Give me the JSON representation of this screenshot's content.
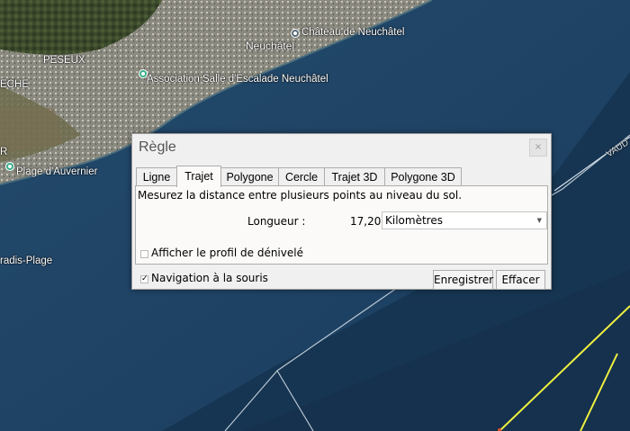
{
  "map": {
    "labels": {
      "peseux": "PESEUX",
      "eche": "ECHE",
      "neuchatel": "Neuchâtel",
      "chateau": "Château de Neuchâtel",
      "association": "Association Salle d'Escalade Neuchâtel",
      "plage_auvernier": "Plage d'Auvernier",
      "paradis_plage": "radis-Plage",
      "r": "R",
      "vaud": "VAUD"
    }
  },
  "dialog": {
    "title": "Règle",
    "close_glyph": "×",
    "tabs": [
      "Ligne",
      "Trajet",
      "Polygone",
      "Cercle",
      "Trajet 3D",
      "Polygone 3D"
    ],
    "active_tab": "Trajet",
    "description": "Mesurez la distance entre plusieurs points au niveau du sol.",
    "length_label": "Longueur :",
    "length_value": "17,20",
    "unit_selected": "Kilomètres",
    "elevation_profile_label": "Afficher le profil de dénivelé",
    "mouse_nav_label": "Navigation à la souris",
    "mouse_nav_check": "✓",
    "save_button": "Enregistrer",
    "clear_button": "Effacer"
  },
  "colors": {
    "water": "#1a3c5e",
    "path": "#f0f040"
  }
}
